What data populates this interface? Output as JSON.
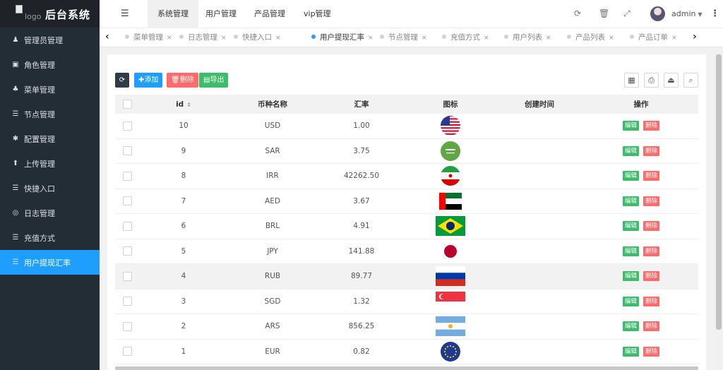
{
  "app": {
    "title": "后台系统",
    "logo_alt": "logo"
  },
  "sidebar": {
    "items": [
      {
        "label": "管理员管理",
        "icon": "user-icon",
        "glyph": "♟"
      },
      {
        "label": "角色管理",
        "icon": "role-icon",
        "glyph": "▣"
      },
      {
        "label": "菜单管理",
        "icon": "tree-icon",
        "glyph": "♣"
      },
      {
        "label": "节点管理",
        "icon": "list-icon",
        "glyph": "☰"
      },
      {
        "label": "配置管理",
        "icon": "gear-icon",
        "glyph": "✱"
      },
      {
        "label": "上传管理",
        "icon": "upload-icon",
        "glyph": "⬆"
      },
      {
        "label": "快捷入口",
        "icon": "list-icon",
        "glyph": "☰"
      },
      {
        "label": "日志管理",
        "icon": "log-icon",
        "glyph": "◎"
      },
      {
        "label": "充值方式",
        "icon": "list-icon",
        "glyph": "☰"
      },
      {
        "label": "用户提现汇率",
        "icon": "list-icon",
        "glyph": "☰",
        "active": true
      }
    ]
  },
  "header": {
    "toggle_glyph": "☰",
    "tabs": [
      {
        "label": "系统管理",
        "active": true
      },
      {
        "label": "用户管理"
      },
      {
        "label": "产品管理"
      },
      {
        "label": "vip管理"
      }
    ],
    "icons": {
      "refresh": "⟳",
      "trash": "🗑",
      "fullscreen": "⤢",
      "more": "⋮"
    },
    "user": {
      "name": "admin",
      "caret": "▼"
    }
  },
  "page_tabs": {
    "prev": "‹",
    "next": "›",
    "close": "×",
    "items": [
      {
        "label": "菜单管理"
      },
      {
        "label": "日志管理"
      },
      {
        "label": "快捷入口"
      },
      {
        "label": "用户提现汇率",
        "active": true
      },
      {
        "label": "节点管理"
      },
      {
        "label": "充值方式"
      },
      {
        "label": "用户列表"
      },
      {
        "label": "产品列表"
      },
      {
        "label": "产品订单"
      }
    ]
  },
  "toolbar": {
    "refresh_glyph": "⟳",
    "add_label": "✚添加",
    "delete_label": "🗑删除",
    "export_label": "▤导出",
    "tools": [
      "▦",
      "⎙",
      "⏏",
      "⌕"
    ]
  },
  "table": {
    "columns": {
      "id": "id",
      "name": "币种名称",
      "rate": "汇率",
      "icon": "图标",
      "created": "创建时间",
      "op": "操作"
    },
    "sort_glyph": "⇕",
    "edit_label": "编辑",
    "delete_label": "删除",
    "rows": [
      {
        "id": "10",
        "name": "USD",
        "rate": "1.00",
        "created": "",
        "flag": "us"
      },
      {
        "id": "9",
        "name": "SAR",
        "rate": "3.75",
        "created": "",
        "flag": "sa"
      },
      {
        "id": "8",
        "name": "IRR",
        "rate": "42262.50",
        "created": "",
        "flag": "ir"
      },
      {
        "id": "7",
        "name": "AED",
        "rate": "3.67",
        "created": "",
        "flag": "ae"
      },
      {
        "id": "6",
        "name": "BRL",
        "rate": "4.91",
        "created": "",
        "flag": "br"
      },
      {
        "id": "5",
        "name": "JPY",
        "rate": "141.88",
        "created": "",
        "flag": "jp"
      },
      {
        "id": "4",
        "name": "RUB",
        "rate": "89.77",
        "created": "",
        "flag": "ru",
        "highlight": true
      },
      {
        "id": "3",
        "name": "SGD",
        "rate": "1.32",
        "created": "",
        "flag": "sg"
      },
      {
        "id": "2",
        "name": "ARS",
        "rate": "856.25",
        "created": "",
        "flag": "ar"
      },
      {
        "id": "1",
        "name": "EUR",
        "rate": "0.82",
        "created": "",
        "flag": "eu"
      }
    ]
  }
}
